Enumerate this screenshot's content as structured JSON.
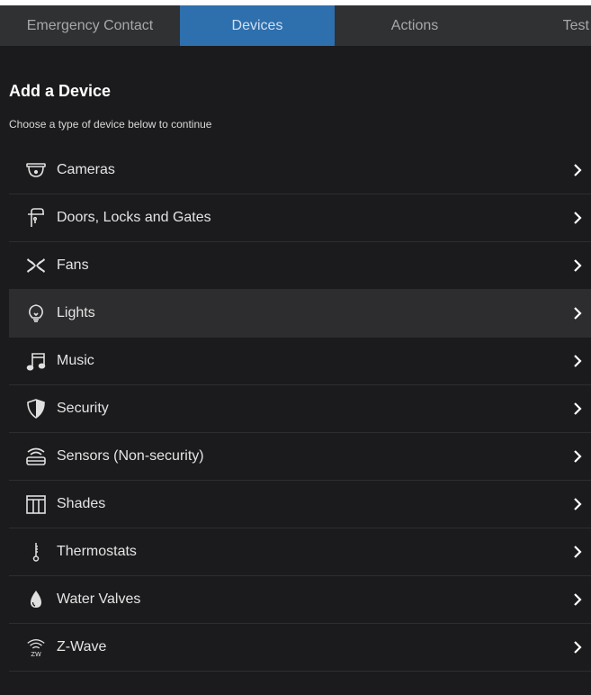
{
  "tabs": [
    {
      "label": "Emergency Contact",
      "active": false
    },
    {
      "label": "Devices",
      "active": true
    },
    {
      "label": "Actions",
      "active": false
    },
    {
      "label": "Test",
      "active": false
    }
  ],
  "heading": "Add a Device",
  "subheading": "Choose a type of device below to continue",
  "items": [
    {
      "label": "Cameras",
      "icon": "camera-icon"
    },
    {
      "label": "Doors, Locks and Gates",
      "icon": "door-lock-icon"
    },
    {
      "label": "Fans",
      "icon": "fan-icon"
    },
    {
      "label": "Lights",
      "icon": "lightbulb-icon",
      "highlighted": true
    },
    {
      "label": "Music",
      "icon": "music-note-icon"
    },
    {
      "label": "Security",
      "icon": "shield-icon"
    },
    {
      "label": "Sensors (Non-security)",
      "icon": "sensor-icon"
    },
    {
      "label": "Shades",
      "icon": "shades-icon"
    },
    {
      "label": "Thermostats",
      "icon": "thermometer-icon"
    },
    {
      "label": "Water Valves",
      "icon": "water-drop-icon"
    },
    {
      "label": "Z-Wave",
      "icon": "zwave-icon"
    }
  ],
  "colors": {
    "background": "#1b1b1d",
    "tab_bar": "#303133",
    "active_tab": "#2e6fad",
    "highlight_row": "#2d2d2f"
  }
}
